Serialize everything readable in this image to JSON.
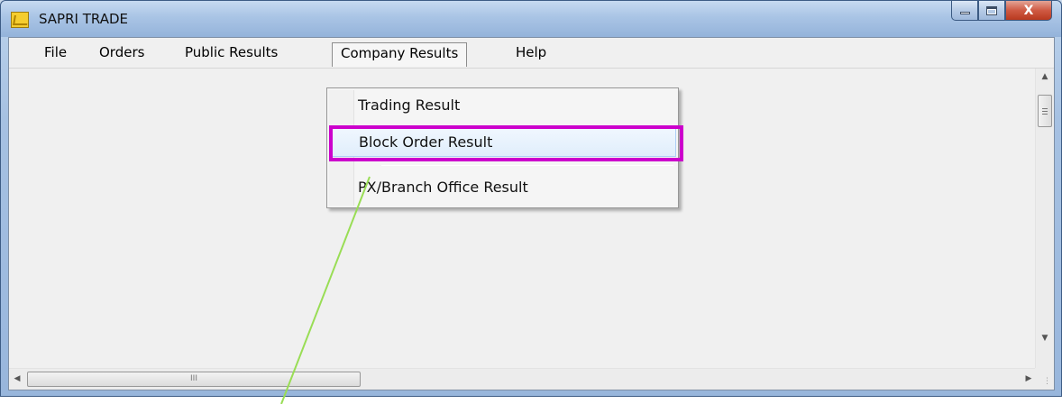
{
  "window": {
    "title": "SAPRI TRADE",
    "close_glyph": "X"
  },
  "menubar": {
    "items": [
      {
        "label": "File"
      },
      {
        "label": "Orders"
      },
      {
        "label": "Public Results"
      },
      {
        "label": "Company Results"
      },
      {
        "label": "Help"
      }
    ],
    "active_index": 3
  },
  "dropdown": {
    "items": [
      {
        "label": "Trading Result"
      },
      {
        "label": "Block Order Result"
      },
      {
        "label": "PX/Branch Office Result"
      }
    ],
    "highlighted_index": 1
  },
  "scrollbars": {
    "h_thumb_grip": "III"
  },
  "colors": {
    "highlight_box": "#cc00cc",
    "annotation_line": "#99dd55",
    "close_button": "#c9452a"
  },
  "icons": {
    "app": "app-icon",
    "minimize": "minimize-icon",
    "maximize": "maximize-icon",
    "close": "close-icon"
  }
}
